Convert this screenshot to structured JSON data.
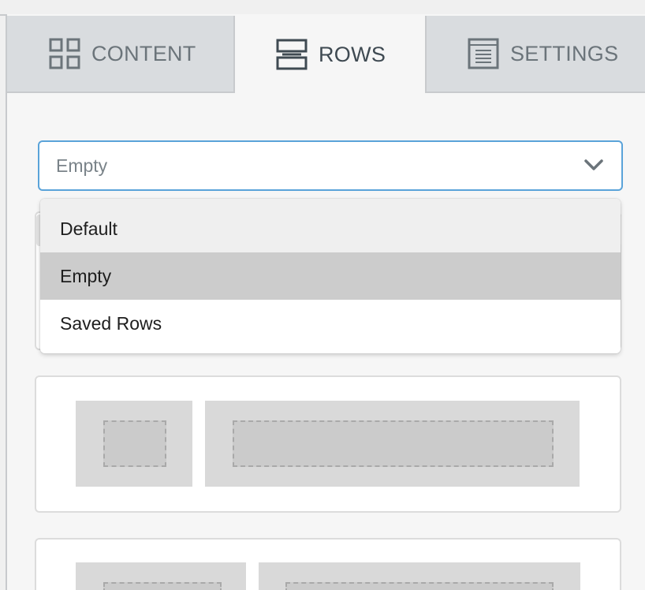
{
  "tabs": [
    {
      "label": "CONTENT",
      "icon": "grid-icon",
      "active": false
    },
    {
      "label": "ROWS",
      "icon": "rows-icon",
      "active": true
    },
    {
      "label": "SETTINGS",
      "icon": "document-icon",
      "active": false
    }
  ],
  "row_select": {
    "value": "Empty",
    "options": [
      "Default",
      "Empty",
      "Saved Rows"
    ],
    "highlighted": "Empty",
    "hovered": "Default"
  },
  "colors": {
    "accent_border": "#5aa3d9",
    "active_tab_text": "#3f4a52",
    "inactive_tab_text": "#6b747a"
  }
}
